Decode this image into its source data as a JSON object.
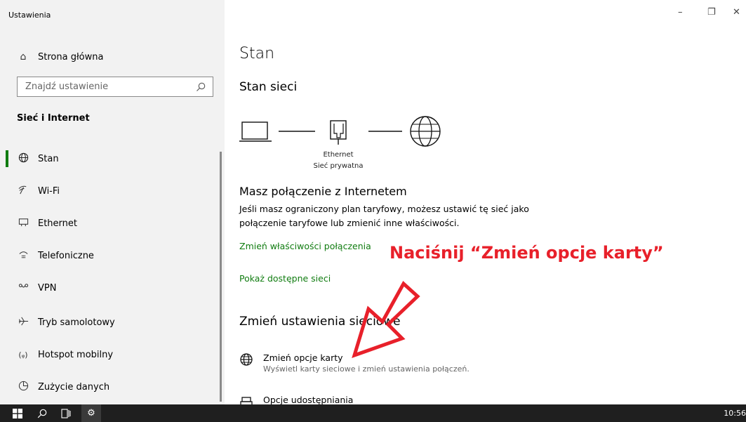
{
  "window": {
    "app_title": "Ustawienia",
    "controls": {
      "minimize": "–",
      "restore": "❐",
      "close": "✕"
    }
  },
  "sidebar": {
    "home_label": "Strona główna",
    "search_placeholder": "Znajdź ustawienie",
    "section_title": "Sieć i Internet",
    "items": [
      {
        "label": "Stan",
        "icon": "globe-icon",
        "active": true
      },
      {
        "label": "Wi-Fi",
        "icon": "wifi-icon"
      },
      {
        "label": "Ethernet",
        "icon": "ethernet-icon"
      },
      {
        "label": "Telefoniczne",
        "icon": "dialup-icon"
      },
      {
        "label": "VPN",
        "icon": "vpn-icon"
      },
      {
        "label": "Tryb samolotowy",
        "icon": "airplane-icon"
      },
      {
        "label": "Hotspot mobilny",
        "icon": "hotspot-icon"
      },
      {
        "label": "Zużycie danych",
        "icon": "data-usage-icon"
      }
    ]
  },
  "main": {
    "title": "Stan",
    "subtitle": "Stan sieci",
    "diagram": {
      "adapter": "Ethernet",
      "network": "Sieć prywatna"
    },
    "connection_title": "Masz połączenie z Internetem",
    "connection_desc": "Jeśli masz ograniczony plan taryfowy, możesz ustawić tę sieć jako połączenie taryfowe lub zmienić inne właściwości.",
    "links": {
      "change_properties": "Zmień właściwości połączenia",
      "show_networks": "Pokaż dostępne sieci"
    },
    "change_title": "Zmień ustawienia sieciowe",
    "options": [
      {
        "title": "Zmień opcje karty",
        "desc": "Wyświetl karty sieciowe i zmień ustawienia połączeń.",
        "icon": "globe-icon"
      },
      {
        "title": "Opcje udostępniania",
        "desc": "",
        "icon": "sharing-icon"
      }
    ]
  },
  "annotation": {
    "text": "Naciśnij “Zmień opcje karty”",
    "color": "#e8202a"
  },
  "taskbar": {
    "clock": "10:56"
  },
  "colors": {
    "accent": "#107c10",
    "sidebar_bg": "#f2f2f2",
    "taskbar_bg": "#1f1f1f"
  }
}
